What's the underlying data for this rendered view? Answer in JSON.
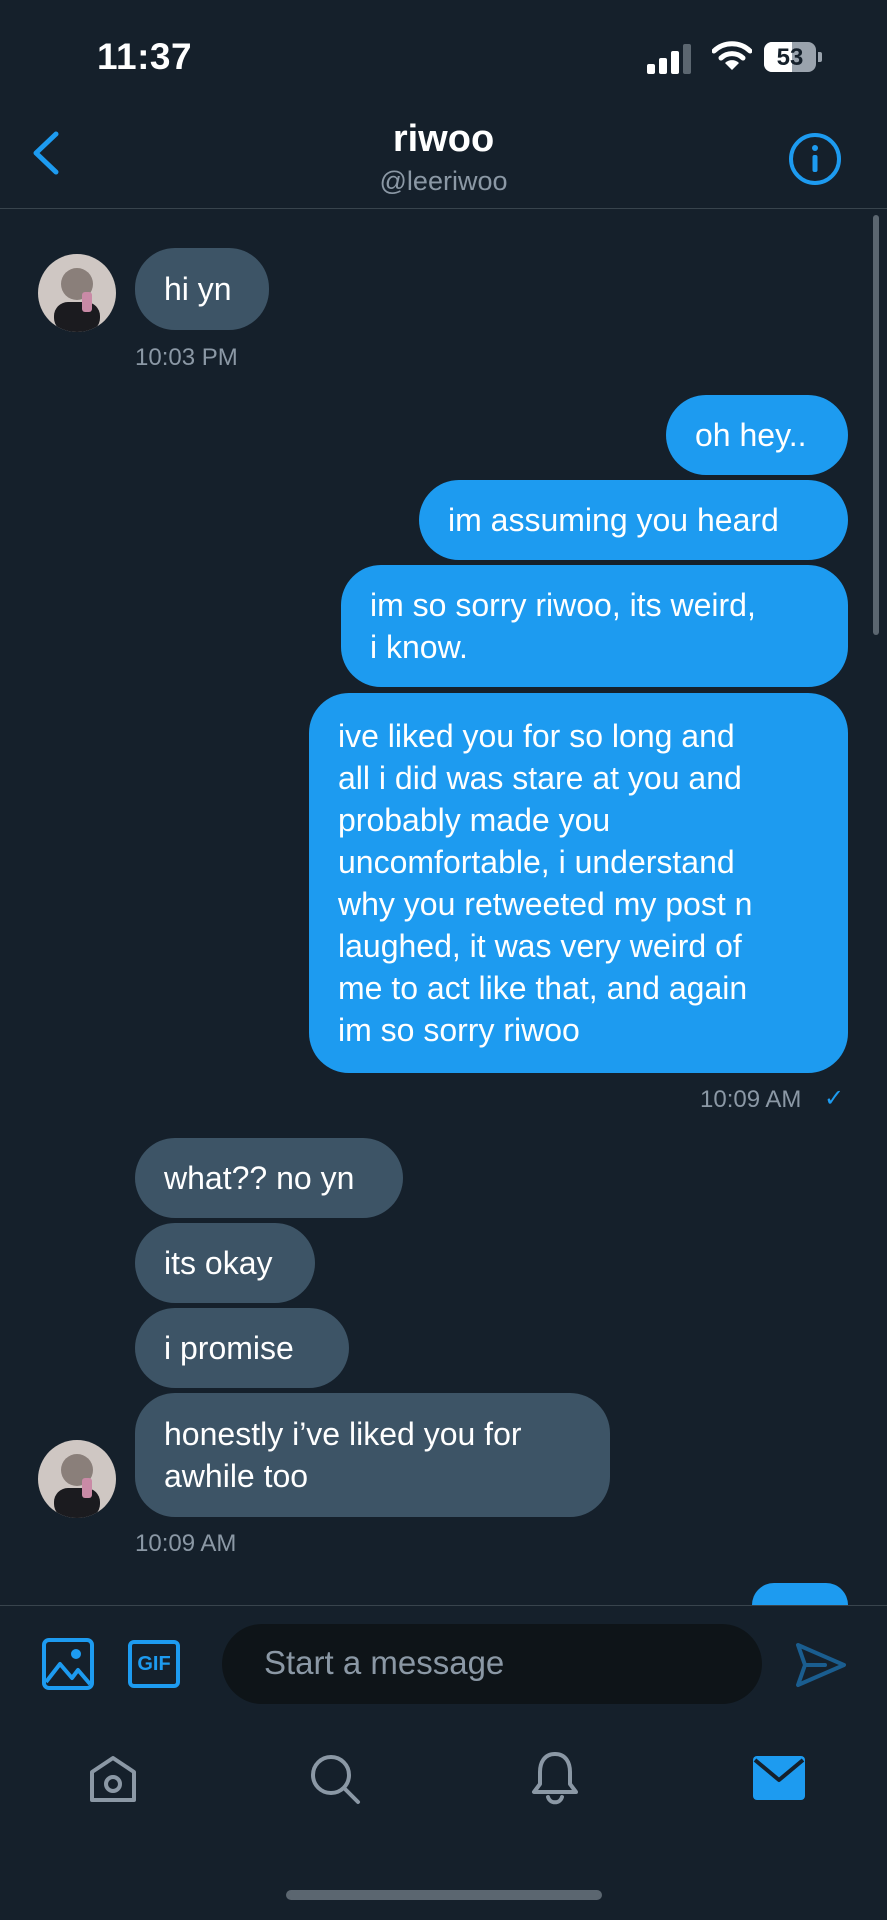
{
  "status_bar": {
    "time": "11:37",
    "battery": "53",
    "battery_level": 0.53
  },
  "header": {
    "name": "riwoo",
    "handle": "@leeriwoo"
  },
  "messages": [
    {
      "from": "them",
      "text": "hi yn"
    },
    {
      "from": "them",
      "timestamp": "10:03 PM"
    },
    {
      "from": "me",
      "text": "oh hey.."
    },
    {
      "from": "me",
      "text": "im assuming you heard"
    },
    {
      "from": "me",
      "text": "im so sorry riwoo, its weird,\ni know."
    },
    {
      "from": "me",
      "text": "ive liked you for so long and\nall i did was stare at you and\nprobably made you\nuncomfortable, i understand\nwhy you retweeted my post n\nlaughed, it was very weird of\nme to act like that, and again\nim so sorry riwoo"
    },
    {
      "from": "me",
      "timestamp": "10:09 AM",
      "status": "✓"
    },
    {
      "from": "them",
      "text": "what?? no yn"
    },
    {
      "from": "them",
      "text": "its okay"
    },
    {
      "from": "them",
      "text": "i promise"
    },
    {
      "from": "them",
      "text": "honestly i’ve liked you for\nawhile too"
    },
    {
      "from": "them",
      "timestamp": "10:09 AM"
    }
  ],
  "composer": {
    "placeholder": "Start a message",
    "gif_label": "GIF"
  },
  "colors": {
    "background": "#15202b",
    "accent": "#1d9bf0",
    "incoming_bubble": "#3d5466"
  },
  "icons": [
    "back-chevron-icon",
    "info-icon",
    "image-icon",
    "gif-icon",
    "send-icon",
    "home-icon",
    "search-icon",
    "bell-icon",
    "mail-icon"
  ]
}
